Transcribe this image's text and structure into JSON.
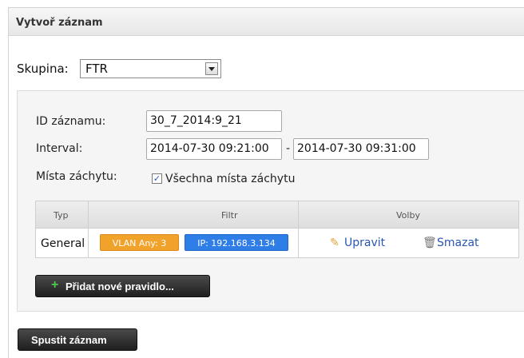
{
  "panel": {
    "title": "Vytvoř záznam"
  },
  "group": {
    "label": "Skupina:",
    "selected": "FTR"
  },
  "form": {
    "id_label": "ID záznamu:",
    "id_value": "30_7_2014:9_21",
    "interval_label": "Interval:",
    "interval_from": "2014-07-30 09:21:00",
    "interval_separator": "-",
    "interval_to": "2014-07-30 09:31:00",
    "capture_label": "Místa záchytu:",
    "capture_checkbox_checked": true,
    "capture_checkbox_label": "Všechna místa záchytu"
  },
  "table": {
    "headers": [
      "Typ",
      "Filtr",
      "Volby"
    ],
    "rows": [
      {
        "type": "General",
        "filters": [
          {
            "text": "VLAN Any: 3",
            "color": "#f0a22b"
          },
          {
            "text": "IP: 192.168.3.134",
            "color": "#2f7ee8"
          }
        ],
        "actions": [
          {
            "label": "Upravit",
            "icon": "pencil-icon"
          },
          {
            "label": "Smazat",
            "icon": "trash-icon"
          }
        ]
      }
    ]
  },
  "buttons": {
    "add_rule": "Přidat nové pravidlo...",
    "start_recording": "Spustit záznam"
  }
}
